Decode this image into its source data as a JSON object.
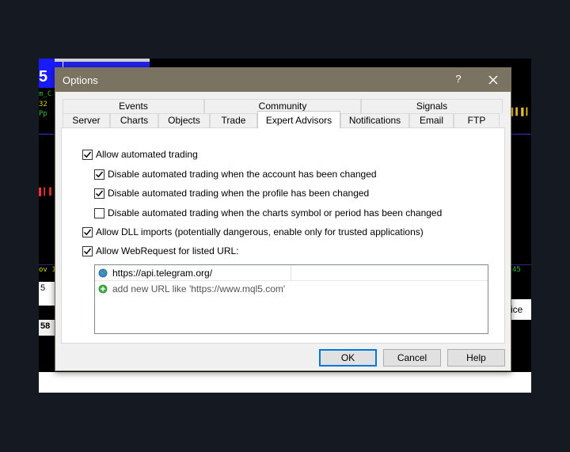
{
  "background": {
    "tab_digit": "5",
    "ticker_1": "m_C",
    "ticker_2": "32",
    "ticker_3": "Pp",
    "bottom_label": "ov 10",
    "right_label": "ice",
    "left_label_1": "5",
    "left_label_2": "58",
    "right_green": "45"
  },
  "dialog": {
    "title": "Options",
    "help_symbol": "?",
    "tabs_row_top": [
      "Events",
      "Community",
      "Signals"
    ],
    "tabs_row_bottom": [
      "Server",
      "Charts",
      "Objects",
      "Trade",
      "Expert Advisors",
      "Notifications",
      "Email",
      "FTP"
    ],
    "active_tab": "Expert Advisors",
    "options": {
      "allow_automated": {
        "label": "Allow automated trading",
        "checked": true
      },
      "disable_account": {
        "label": "Disable automated trading when the account has been changed",
        "checked": true
      },
      "disable_profile": {
        "label": "Disable automated trading when the profile has been changed",
        "checked": true
      },
      "disable_symbol": {
        "label": "Disable automated trading when the charts symbol or period has been changed",
        "checked": false
      },
      "allow_dll": {
        "label": "Allow DLL imports (potentially dangerous, enable only for trusted applications)",
        "checked": true
      },
      "allow_webrequest": {
        "label": "Allow WebRequest for listed URL:",
        "checked": true
      }
    },
    "url_list": {
      "urls": [
        "https://api.telegram.org/"
      ],
      "add_hint": "add new URL like 'https://www.mql5.com'"
    },
    "buttons": {
      "ok": "OK",
      "cancel": "Cancel",
      "help": "Help"
    }
  },
  "colors": {
    "titlebar": "#7b7361",
    "accent": "#0078d7"
  }
}
